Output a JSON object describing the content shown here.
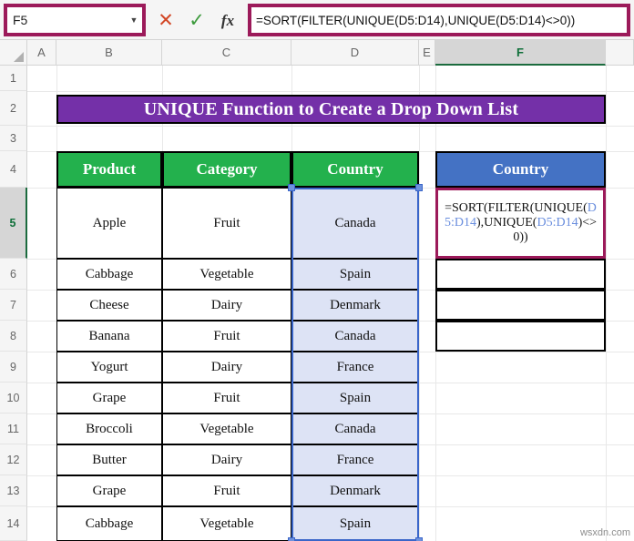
{
  "formula_bar": {
    "name_box_value": "F5",
    "name_box_placeholder": "Name Box",
    "dropdown_icon": "chevron-down-icon",
    "cancel_icon": "✕",
    "enter_icon": "✓",
    "function_icon": "fx",
    "formula_value": "=SORT(FILTER(UNIQUE(D5:D14),UNIQUE(D5:D14)<>0))"
  },
  "columns": [
    {
      "label": "A",
      "selected": false
    },
    {
      "label": "B",
      "selected": false
    },
    {
      "label": "C",
      "selected": false
    },
    {
      "label": "D",
      "selected": false
    },
    {
      "label": "E",
      "selected": false
    },
    {
      "label": "F",
      "selected": true
    }
  ],
  "rows": [
    {
      "label": "1",
      "selected": false
    },
    {
      "label": "2",
      "selected": false
    },
    {
      "label": "3",
      "selected": false
    },
    {
      "label": "4",
      "selected": false
    },
    {
      "label": "5",
      "selected": true
    },
    {
      "label": "6",
      "selected": false
    },
    {
      "label": "7",
      "selected": false
    },
    {
      "label": "8",
      "selected": false
    },
    {
      "label": "9",
      "selected": false
    },
    {
      "label": "10",
      "selected": false
    },
    {
      "label": "11",
      "selected": false
    },
    {
      "label": "12",
      "selected": false
    },
    {
      "label": "13",
      "selected": false
    },
    {
      "label": "14",
      "selected": false
    }
  ],
  "title_banner": {
    "text": "UNIQUE Function to Create a Drop Down List",
    "background": "#7430a8",
    "text_color": "#ffffff"
  },
  "table": {
    "headers": [
      "Product",
      "Category",
      "Country"
    ],
    "header_background": "#23b14d",
    "rows": [
      {
        "product": "Apple",
        "category": "Fruit",
        "country": "Canada"
      },
      {
        "product": "Cabbage",
        "category": "Vegetable",
        "country": "Spain"
      },
      {
        "product": "Cheese",
        "category": "Dairy",
        "country": "Denmark"
      },
      {
        "product": "Banana",
        "category": "Fruit",
        "country": "Canada"
      },
      {
        "product": "Yogurt",
        "category": "Dairy",
        "country": "France"
      },
      {
        "product": "Grape",
        "category": "Fruit",
        "country": "Spain"
      },
      {
        "product": "Broccoli",
        "category": "Vegetable",
        "country": "Canada"
      },
      {
        "product": "Butter",
        "category": "Dairy",
        "country": "France"
      },
      {
        "product": "Grape",
        "category": "Fruit",
        "country": "Denmark"
      },
      {
        "product": "Cabbage",
        "category": "Vegetable",
        "country": "Spain"
      }
    ]
  },
  "output_table": {
    "header": "Country",
    "header_background": "#4472c4",
    "active_cell_reference": "F5",
    "formula_parts": [
      {
        "text": "=SORT(FILTER(UNI",
        "type": "plain"
      },
      {
        "text": "QUE(",
        "type": "plain"
      },
      {
        "text": "D5:D14",
        "type": "ref"
      },
      {
        "text": "),UNIQ",
        "type": "plain"
      },
      {
        "text": "UE(",
        "type": "plain"
      },
      {
        "text": "D5:D14",
        "type": "ref"
      },
      {
        "text": ")<>0))",
        "type": "plain"
      }
    ],
    "empty_cells": [
      "",
      "",
      ""
    ]
  },
  "selection": {
    "range": "D5:D14",
    "fill_color": "#dde3f5",
    "border_color": "#3a66c9",
    "active_cell_border_color": "#9c1a5a"
  },
  "watermark": "wsxdn.com"
}
